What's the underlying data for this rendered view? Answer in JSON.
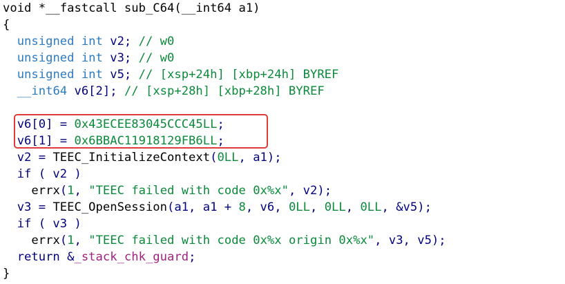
{
  "code": {
    "lines": [
      [
        {
          "t": "void *__fastcall sub_C64(__int64 a1)",
          "c": "plain"
        }
      ],
      [
        {
          "t": "{",
          "c": "plain"
        }
      ],
      [
        {
          "t": "  ",
          "c": "plain"
        },
        {
          "t": "unsigned int",
          "c": "type"
        },
        {
          "t": " v2; ",
          "c": "var"
        },
        {
          "t": "// w0",
          "c": "cmt"
        }
      ],
      [
        {
          "t": "  ",
          "c": "plain"
        },
        {
          "t": "unsigned int",
          "c": "type"
        },
        {
          "t": " v3; ",
          "c": "var"
        },
        {
          "t": "// w0",
          "c": "cmt"
        }
      ],
      [
        {
          "t": "  ",
          "c": "plain"
        },
        {
          "t": "unsigned int",
          "c": "type"
        },
        {
          "t": " v5; ",
          "c": "var"
        },
        {
          "t": "// [xsp+24h] [xbp+24h] BYREF",
          "c": "cmt"
        }
      ],
      [
        {
          "t": "  ",
          "c": "plain"
        },
        {
          "t": "__int64",
          "c": "type"
        },
        {
          "t": " v6[2]; ",
          "c": "var"
        },
        {
          "t": "// [xsp+28h] [xbp+28h] BYREF",
          "c": "cmt"
        }
      ],
      [
        {
          "t": "",
          "c": "plain"
        }
      ],
      [
        {
          "t": "  v6[0] = ",
          "c": "var"
        },
        {
          "t": "0x43ECEE83045CCC45LL",
          "c": "num"
        },
        {
          "t": ";",
          "c": "var"
        }
      ],
      [
        {
          "t": "  v6[1] = ",
          "c": "var"
        },
        {
          "t": "0x6BBAC11918129FB6LL",
          "c": "num"
        },
        {
          "t": ";",
          "c": "var"
        }
      ],
      [
        {
          "t": "  v2 = ",
          "c": "var"
        },
        {
          "t": "TEEC_InitializeContext",
          "c": "plain"
        },
        {
          "t": "(",
          "c": "var"
        },
        {
          "t": "0LL",
          "c": "num"
        },
        {
          "t": ", a1);",
          "c": "var"
        }
      ],
      [
        {
          "t": "  if ( v2 )",
          "c": "kw"
        }
      ],
      [
        {
          "t": "    ",
          "c": "plain"
        },
        {
          "t": "errx",
          "c": "plain"
        },
        {
          "t": "(",
          "c": "var"
        },
        {
          "t": "1",
          "c": "num"
        },
        {
          "t": ", ",
          "c": "var"
        },
        {
          "t": "\"TEEC failed with code 0x%x\"",
          "c": "str"
        },
        {
          "t": ", v2);",
          "c": "var"
        }
      ],
      [
        {
          "t": "  v3 = ",
          "c": "var"
        },
        {
          "t": "TEEC_OpenSession",
          "c": "plain"
        },
        {
          "t": "(a1, a1 + ",
          "c": "var"
        },
        {
          "t": "8",
          "c": "num"
        },
        {
          "t": ", v6, ",
          "c": "var"
        },
        {
          "t": "0LL",
          "c": "num"
        },
        {
          "t": ", ",
          "c": "var"
        },
        {
          "t": "0LL",
          "c": "num"
        },
        {
          "t": ", ",
          "c": "var"
        },
        {
          "t": "0LL",
          "c": "num"
        },
        {
          "t": ", &v5);",
          "c": "var"
        }
      ],
      [
        {
          "t": "  if ( v3 )",
          "c": "kw"
        }
      ],
      [
        {
          "t": "    ",
          "c": "plain"
        },
        {
          "t": "errx",
          "c": "plain"
        },
        {
          "t": "(",
          "c": "var"
        },
        {
          "t": "1",
          "c": "num"
        },
        {
          "t": ", ",
          "c": "var"
        },
        {
          "t": "\"TEEC failed with code 0x%x origin 0x%x\"",
          "c": "str"
        },
        {
          "t": ", v3, v5);",
          "c": "var"
        }
      ],
      [
        {
          "t": "  return &",
          "c": "kw"
        },
        {
          "t": "_stack_chk_guard",
          "c": "gvar"
        },
        {
          "t": ";",
          "c": "var"
        }
      ],
      [
        {
          "t": "}",
          "c": "plain"
        }
      ]
    ]
  },
  "highlight": {
    "color": "#e03a3a",
    "covers_lines": [
      8,
      9
    ]
  }
}
